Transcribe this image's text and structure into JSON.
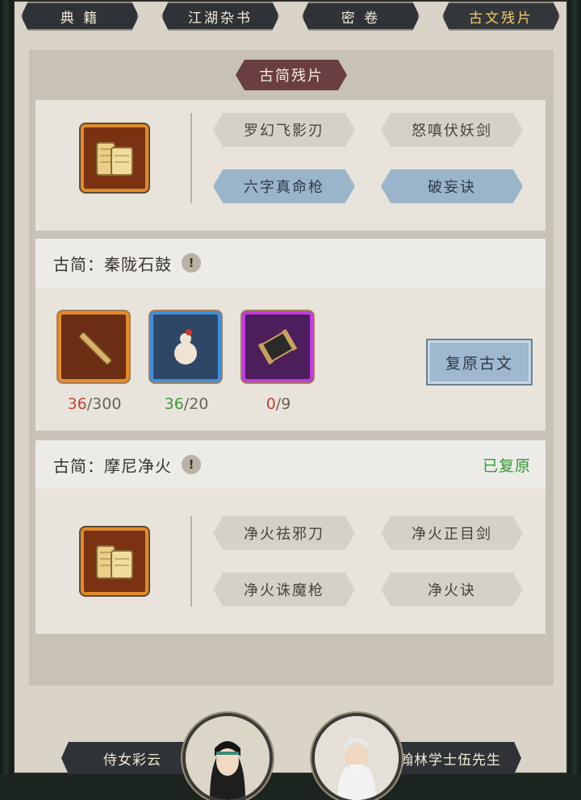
{
  "tabs": [
    {
      "label": "典 籍",
      "active": false
    },
    {
      "label": "江湖杂书",
      "active": false
    },
    {
      "label": "密 卷",
      "active": false
    },
    {
      "label": "古文残片",
      "active": true
    }
  ],
  "section_title": "古简残片",
  "fragment_panel": {
    "icon": "scroll-icon",
    "skills": [
      {
        "label": "罗幻飞影刃",
        "style": "gray"
      },
      {
        "label": "怒嗔伏妖剑",
        "style": "gray"
      },
      {
        "label": "六字真命枪",
        "style": "blue"
      },
      {
        "label": "破妄诀",
        "style": "blue"
      }
    ]
  },
  "card_qinlong": {
    "title": "古简：秦陇石鼓",
    "info_symbol": "!",
    "materials": [
      {
        "icon": "bamboo-slip-icon",
        "rarity": "orange",
        "have": "36",
        "need": "/300",
        "have_color": "#c0443a"
      },
      {
        "icon": "gourd-icon",
        "rarity": "blue",
        "have": "36",
        "need": "/20",
        "have_color": "#3d9a3d"
      },
      {
        "icon": "scroll-spool-icon",
        "rarity": "purple",
        "have": "0",
        "need": "/9",
        "have_color": "#c0443a"
      }
    ],
    "button": "复原古文"
  },
  "card_moni": {
    "title": "古简：摩尼净火",
    "info_symbol": "!",
    "status": "已复原",
    "icon": "scroll-icon",
    "skills": [
      {
        "label": "净火祛邪刀"
      },
      {
        "label": "净火正目剑"
      },
      {
        "label": "净火诛魔枪"
      },
      {
        "label": "净火诀"
      }
    ]
  },
  "npcs": [
    {
      "name": "侍女彩云",
      "portrait": "maid-portrait"
    },
    {
      "name": "翰林学士伍先生",
      "portrait": "scholar-portrait"
    }
  ],
  "colors": {
    "accent_gold": "#f2c96b",
    "restored_green": "#2f9a2f",
    "ribbon": "#6b3f42"
  }
}
